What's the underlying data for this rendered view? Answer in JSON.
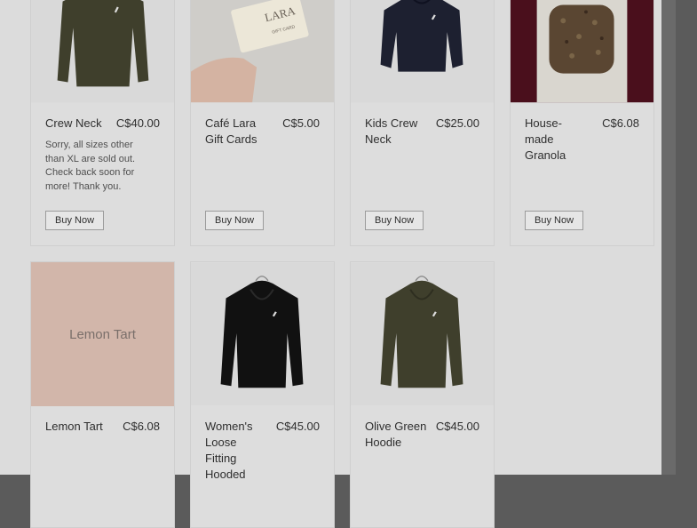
{
  "products": [
    {
      "name": "Crew Neck",
      "price": "C$40.00",
      "note": "Sorry, all sizes other than XL are sold out. Check back soon for more! Thank you.",
      "button": "Buy Now",
      "image": "olive-sweatshirt-image"
    },
    {
      "name": "Café Lara Gift Cards",
      "price": "C$5.00",
      "note": "",
      "button": "Buy Now",
      "image": "gift-card-image",
      "card_logo": "LARA",
      "card_caption": "GIFT CARD"
    },
    {
      "name": "Kids Crew Neck",
      "price": "C$25.00",
      "note": "",
      "button": "Buy Now",
      "image": "navy-sweatshirt-image"
    },
    {
      "name": "House-made Granola",
      "price": "C$6.08",
      "note": "",
      "button": "Buy Now",
      "image": "granola-bag-image"
    },
    {
      "name": "Lemon Tart",
      "price": "C$6.08",
      "placeholder": "Lemon Tart",
      "image": "placeholder-image"
    },
    {
      "name": "Women's Loose Fitting Hooded",
      "price": "C$45.00",
      "image": "black-hoodie-image"
    },
    {
      "name": "Olive Green Hoodie",
      "price": "C$45.00",
      "image": "olive-hoodie-image"
    }
  ],
  "colors": {
    "overlay_bg": "#5b5b5b",
    "page_bg": "#dcdcdc",
    "placeholder_bg": "#d2b6aa",
    "olive": "#3f3f2c",
    "navy": "#1d2030",
    "black": "#111111"
  }
}
